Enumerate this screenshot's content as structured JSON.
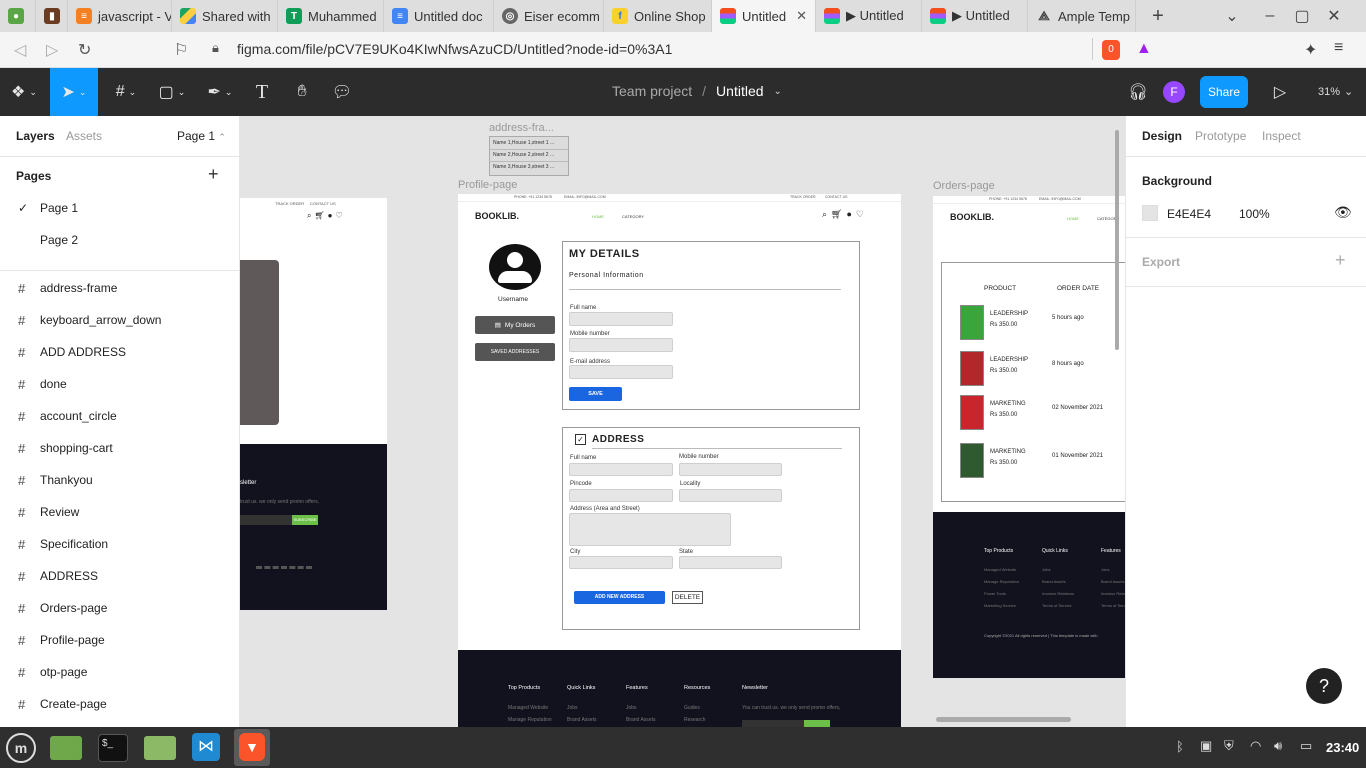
{
  "browser": {
    "tabs": [
      {
        "label": "",
        "icon": "green-app-icon"
      },
      {
        "label": "",
        "icon": "book-icon"
      },
      {
        "label": "javascript - V",
        "icon": "stackoverflow-icon"
      },
      {
        "label": "Shared with",
        "icon": "drive-icon"
      },
      {
        "label": "Muhammed",
        "icon": "sheets-icon"
      },
      {
        "label": "Untitled doc",
        "icon": "docs-icon"
      },
      {
        "label": "Eiser ecomm",
        "icon": "globe-icon"
      },
      {
        "label": "Online Shop",
        "icon": "flipkart-icon"
      },
      {
        "label": "Untitled",
        "icon": "figma-icon",
        "active": true
      },
      {
        "label": "▶ Untitled",
        "icon": "figma-icon"
      },
      {
        "label": "▶ Untitled",
        "icon": "figma-icon"
      },
      {
        "label": "Ample Temp",
        "icon": "ample-icon"
      }
    ],
    "url": "figma.com/file/pCV7E9UKo4KIwNfwsAzuCD/Untitled?node-id=0%3A1",
    "shield_count": "0"
  },
  "figma": {
    "breadcrumb_team": "Team project",
    "breadcrumb_sep": "/",
    "file_name": "Untitled",
    "avatar_letter": "F",
    "share_label": "Share",
    "zoom": "31%"
  },
  "left_panel": {
    "tabs": [
      "Layers",
      "Assets"
    ],
    "page_selector": "Page 1",
    "pages_heading": "Pages",
    "pages": [
      "Page 1",
      "Page 2"
    ],
    "layers": [
      "address-frame",
      "keyboard_arrow_down",
      "ADD ADDRESS",
      "done",
      "account_circle",
      "shopping-cart",
      "Thankyou",
      "Review",
      "Specification",
      "ADDRESS",
      "Orders-page",
      "Profile-page",
      "otp-page",
      "Create-page"
    ]
  },
  "right_panel": {
    "tabs": [
      "Design",
      "Prototype",
      "Inspect"
    ],
    "background_heading": "Background",
    "bg_hex": "E4E4E4",
    "bg_opacity": "100%",
    "export_heading": "Export"
  },
  "canvas": {
    "address_frame_label": "address-fra...",
    "address_items": [
      "Name 1,House 1,street 1 ...",
      "Name 2,House 2,street 2 ...",
      "Name 3,House 3,street 3 ..."
    ],
    "profile_label": "Profile-page",
    "orders_label": "Orders-page",
    "topbar_phone": "PHONE: +91 1234 5678",
    "topbar_email": "EMAIL: INFO@MAIL.COM",
    "topbar_track": "TRACK ORDER",
    "topbar_contact": "CONTACT US",
    "brand": "BOOKLIB.",
    "nav_home": "HOME",
    "nav_category": "CATEGORY",
    "username": "Username",
    "my_orders": "My Orders",
    "saved_addresses": "SAVED ADDRESSES",
    "my_details": "MY DETAILS",
    "personal_info": "Personal Information",
    "full_name": "Full name",
    "mobile": "Mobile number",
    "email": "E-mail address",
    "save": "SAVE",
    "address_heading": "ADDRESS",
    "pincode": "Pincode",
    "locality": "Locality",
    "address_area": "Address (Area and Street)",
    "city": "City",
    "state": "State",
    "add_new_address": "ADD NEW ADDRESS",
    "delete": "DELETE",
    "footer_cols": [
      "Top Products",
      "Quick Links",
      "Features",
      "Resources",
      "Newsletter"
    ],
    "footer_links": [
      [
        "Managed Website",
        "Manage Reputation"
      ],
      [
        "Jobs",
        "Brand Assets"
      ],
      [
        "Jobs",
        "Brand Assets"
      ],
      [
        "Guides",
        "Research"
      ]
    ],
    "newsletter_text": "You can trust us. we only send promo offers,",
    "left_partial_newsletter": "sletter",
    "left_partial_trust": "trust us. we only send promo offers,",
    "left_partial_subscribe": "SUBSCRIBE",
    "orders_table_headers": [
      "PRODUCT",
      "ORDER DATE"
    ],
    "orders_rows": [
      {
        "title": "LEADERSHIP",
        "price": "Rs 350.00",
        "date": "5 hours ago",
        "cover": "#3aa53a"
      },
      {
        "title": "LEADERSHIP",
        "price": "Rs 350.00",
        "date": "8 hours ago",
        "cover": "#b3262a"
      },
      {
        "title": "MARKETING",
        "price": "Rs 350.00",
        "date": "02 November 2021",
        "cover": "#c9252c"
      },
      {
        "title": "MARKETING",
        "price": "Rs 350.00",
        "date": "01 November 2021",
        "cover": "#2f5a2f"
      }
    ],
    "orders_footer_cols": [
      "Top Products",
      "Quick Links",
      "Features"
    ],
    "orders_footer_links": [
      [
        "Managed Website",
        "Manage Reputation",
        "Power Tools",
        "Marketing Service"
      ],
      [
        "Jobs",
        "Brand Assets",
        "Investor Relations",
        "Terms of Service"
      ],
      [
        "Jobs",
        "Brand Assets",
        "Investor Relations",
        "Terms of Service"
      ]
    ],
    "copyright": "Copyright ©2021 All rights reserved | This template is made with"
  },
  "taskbar": {
    "time": "23:40",
    "apps": [
      "mint-menu-icon",
      "files-icon",
      "terminal-icon",
      "folder-icon",
      "vscode-icon",
      "brave-icon"
    ]
  },
  "colors": {
    "accent": "#0d99ff",
    "figma_toolbar": "#2c2c2c",
    "save_button": "#1a66e0",
    "footer": "#12121f"
  }
}
